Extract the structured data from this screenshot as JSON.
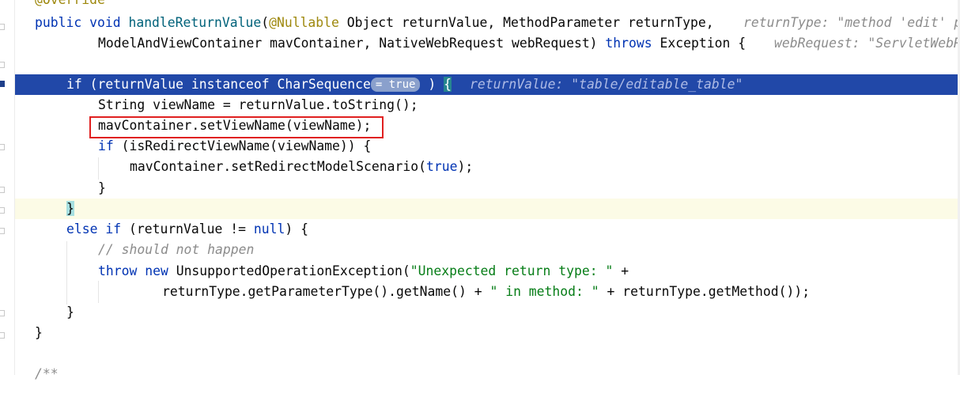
{
  "editor": {
    "lines": {
      "l0": "@Override",
      "l1_kw1": "public",
      "l1_kw2": "void",
      "l1_method": "handleReturnValue",
      "l1_paren": "(",
      "l1_ann": "@Nullable",
      "l1_rest": " Object returnValue, MethodParameter returnType,",
      "l1_hint": "returnType: \"method 'edit' p",
      "l2_text": "ModelAndViewContainer mavContainer, NativeWebRequest webRequest) ",
      "l2_kw": "throws",
      "l2_rest": " Exception {",
      "l2_hint": "webRequest: \"ServletWebR",
      "l4_kw": "if",
      "l4_text": " (returnValue ",
      "l4_kw2": "instanceof",
      "l4_text2": " CharSequence",
      "l4_eval": "= true",
      "l4_close": " )",
      "l4_brace": "{",
      "l4_hint": "returnValue: \"table/editable_table\"",
      "l5": "String viewName = returnValue.toString();",
      "l6": "mavContainer.setViewName(viewName);",
      "l7_kw": "if",
      "l7_text": " (isRedirectViewName(viewName)) {",
      "l8_text": "mavContainer.setRedirectModelScenario(",
      "l8_kw": "true",
      "l8_close": ");",
      "l9": "}",
      "l10": "}",
      "l11_kw1": "else",
      "l11_kw2": "if",
      "l11_text": " (returnValue != ",
      "l11_kw3": "null",
      "l11_close": ") {",
      "l12": "// should not happen",
      "l13_kw1": "throw",
      "l13_kw2": "new",
      "l13_text": " UnsupportedOperationException(",
      "l13_str": "\"Unexpected return type: \"",
      "l13_plus": " +",
      "l14_text": "returnType.getParameterType().getName() + ",
      "l14_str": "\" in method: \"",
      "l14_rest": " + returnType.getMethod());",
      "l15": "}",
      "l16": "}",
      "l17": "/**"
    }
  },
  "colors": {
    "highlight_line": "#2148a8",
    "current_line": "#fcfbe6",
    "keyword": "#0033b3",
    "string": "#067d17",
    "annotation": "#9e880d",
    "red_box": "#e02020"
  }
}
